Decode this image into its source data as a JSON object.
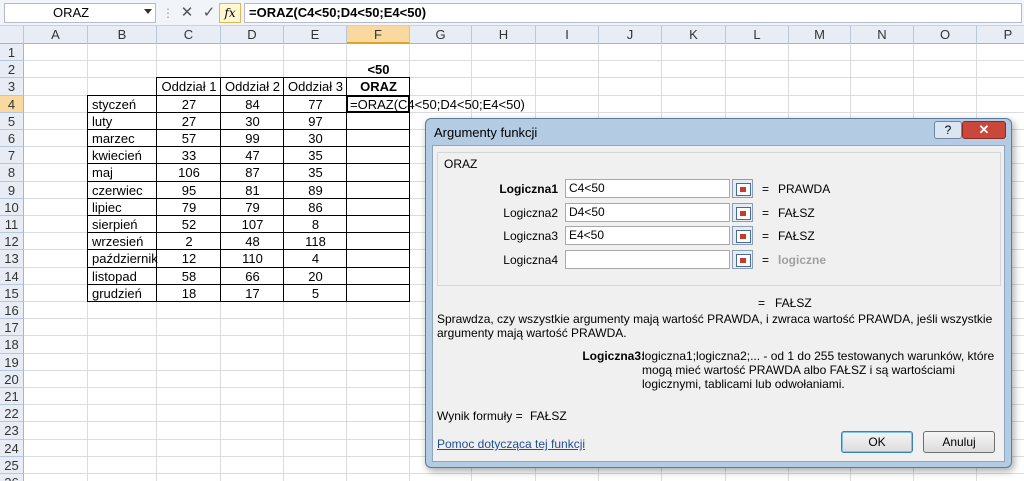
{
  "formula_bar": {
    "name_box": "ORAZ",
    "cancel_glyph": "✕",
    "enter_glyph": "✓",
    "fx_label": "fx",
    "formula": "=ORAZ(C4<50;D4<50;E4<50)"
  },
  "grid": {
    "columns": [
      "A",
      "B",
      "C",
      "D",
      "E",
      "F",
      "G",
      "H",
      "I",
      "J",
      "K",
      "L",
      "M",
      "N",
      "O",
      "P"
    ],
    "rows": [
      "1",
      "2",
      "3",
      "4",
      "5",
      "6",
      "7",
      "8",
      "9",
      "10",
      "11",
      "12",
      "13",
      "14",
      "15",
      "16",
      "17",
      "18",
      "19",
      "20",
      "21",
      "22",
      "23",
      "24",
      "25",
      "26"
    ],
    "header_f2": "<50",
    "header_f3": "ORAZ",
    "col_headers": [
      "Oddział 1",
      "Oddział 2",
      "Oddział 3"
    ],
    "months": [
      "styczeń",
      "luty",
      "marzec",
      "kwiecień",
      "maj",
      "czerwiec",
      "lipiec",
      "sierpień",
      "wrzesień",
      "październik",
      "listopad",
      "grudzień"
    ],
    "values": [
      [
        "27",
        "84",
        "77"
      ],
      [
        "27",
        "30",
        "97"
      ],
      [
        "57",
        "99",
        "30"
      ],
      [
        "33",
        "47",
        "35"
      ],
      [
        "106",
        "87",
        "35"
      ],
      [
        "95",
        "81",
        "89"
      ],
      [
        "79",
        "79",
        "86"
      ],
      [
        "52",
        "107",
        "8"
      ],
      [
        "2",
        "48",
        "118"
      ],
      [
        "12",
        "110",
        "4"
      ],
      [
        "58",
        "66",
        "20"
      ],
      [
        "18",
        "17",
        "5"
      ]
    ],
    "editing_cell": "=ORAZ(C4<50;D4<50;E4<50)"
  },
  "dialog": {
    "title": "Argumenty funkcji",
    "help_glyph": "?",
    "close_glyph": "✕",
    "function_name": "ORAZ",
    "args": [
      {
        "label": "Logiczna1",
        "value": "C4<50",
        "result": "PRAWDA"
      },
      {
        "label": "Logiczna2",
        "value": "D4<50",
        "result": "FAŁSZ"
      },
      {
        "label": "Logiczna3",
        "value": "E4<50",
        "result": "FAŁSZ"
      },
      {
        "label": "Logiczna4",
        "value": "",
        "result": "logiczne"
      }
    ],
    "equals": "=",
    "overall_result": "FAŁSZ",
    "description": "Sprawdza, czy wszystkie argumenty mają wartość PRAWDA, i zwraca wartość PRAWDA, jeśli wszystkie argumenty mają wartość PRAWDA.",
    "arg_help_label": "Logiczna3:",
    "arg_help_text": "logiczna1;logiczna2;... - od 1 do 255 testowanych warunków, które mogą mieć wartość PRAWDA albo FAŁSZ i są wartościami logicznymi, tablicami lub odwołaniami.",
    "formula_result_label": "Wynik formuły =",
    "formula_result_value": "FAŁSZ",
    "help_link": "Pomoc dotycząca tej funkcji",
    "ok_label": "OK",
    "cancel_label": "Anuluj"
  }
}
